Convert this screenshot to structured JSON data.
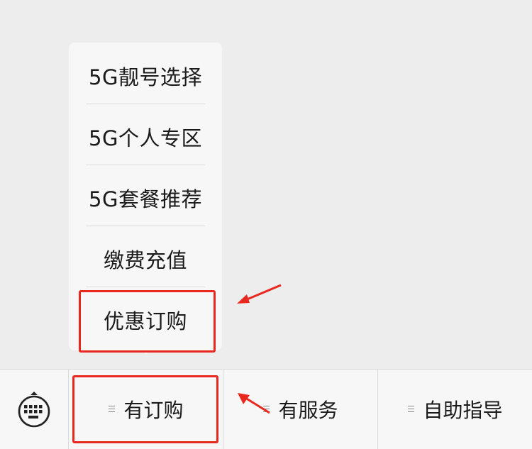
{
  "popup": {
    "items": [
      {
        "label": "5G靓号选择"
      },
      {
        "label": "5G个人专区"
      },
      {
        "label": "5G套餐推荐"
      },
      {
        "label": "缴费充值"
      },
      {
        "label": "优惠订购"
      }
    ]
  },
  "bottom_bar": {
    "keyboard_icon": "keyboard-icon",
    "menus": [
      {
        "label": "有订购",
        "icon": "menu-lines-icon"
      },
      {
        "label": "有服务",
        "icon": "menu-lines-icon"
      },
      {
        "label": "自助指导",
        "icon": "menu-lines-icon"
      }
    ]
  },
  "annotations": {
    "highlight_color": "#E8281E"
  }
}
